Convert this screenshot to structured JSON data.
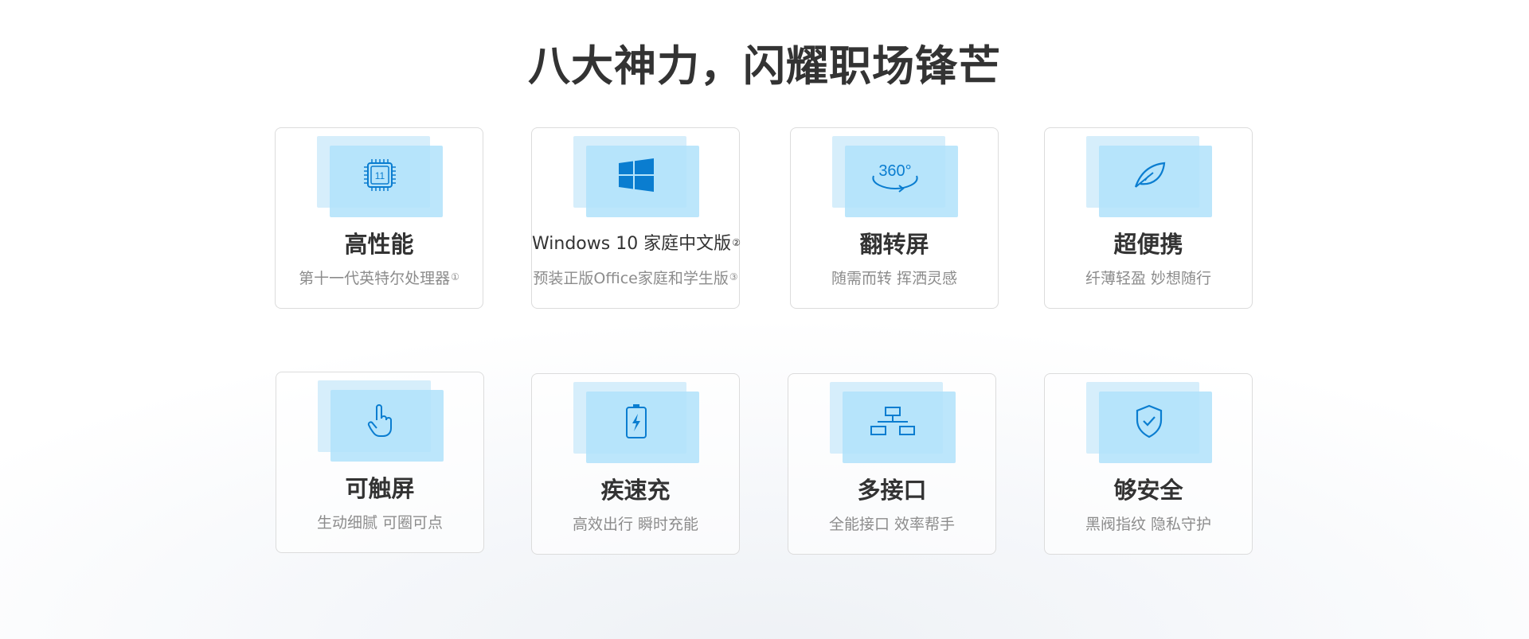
{
  "title": "八大神力，闪耀职场锋芒",
  "colors": {
    "accent": "#0a7dd0",
    "icon_bg_light": "#d6eefb",
    "icon_bg": "#b3e3fb",
    "title_text": "#333333",
    "sub_text": "#8c8c8c",
    "card_border": "#dcdcdc"
  },
  "cards": [
    {
      "icon": "cpu-chip-icon",
      "icon_text": "11",
      "title": "高性能",
      "subtitle": "第十一代英特尔处理器",
      "note": "①"
    },
    {
      "icon": "windows-logo-icon",
      "title": "Windows 10 家庭中文版",
      "title_note": "②",
      "subtitle": "预装正版Office家庭和学生版",
      "note": "③"
    },
    {
      "icon": "rotate-360-icon",
      "icon_text": "360°",
      "title": "翻转屏",
      "subtitle": "随需而转 挥洒灵感"
    },
    {
      "icon": "feather-leaf-icon",
      "title": "超便携",
      "subtitle": "纤薄轻盈 妙想随行"
    },
    {
      "icon": "touch-hand-icon",
      "title": "可触屏",
      "subtitle": "生动细腻 可圈可点"
    },
    {
      "icon": "battery-charging-icon",
      "title": "疾速充",
      "subtitle": "高效出行 瞬时充能"
    },
    {
      "icon": "network-ports-icon",
      "title": "多接口",
      "subtitle": "全能接口 效率帮手"
    },
    {
      "icon": "shield-check-icon",
      "title": "够安全",
      "subtitle": "黑阀指纹 隐私守护"
    }
  ]
}
